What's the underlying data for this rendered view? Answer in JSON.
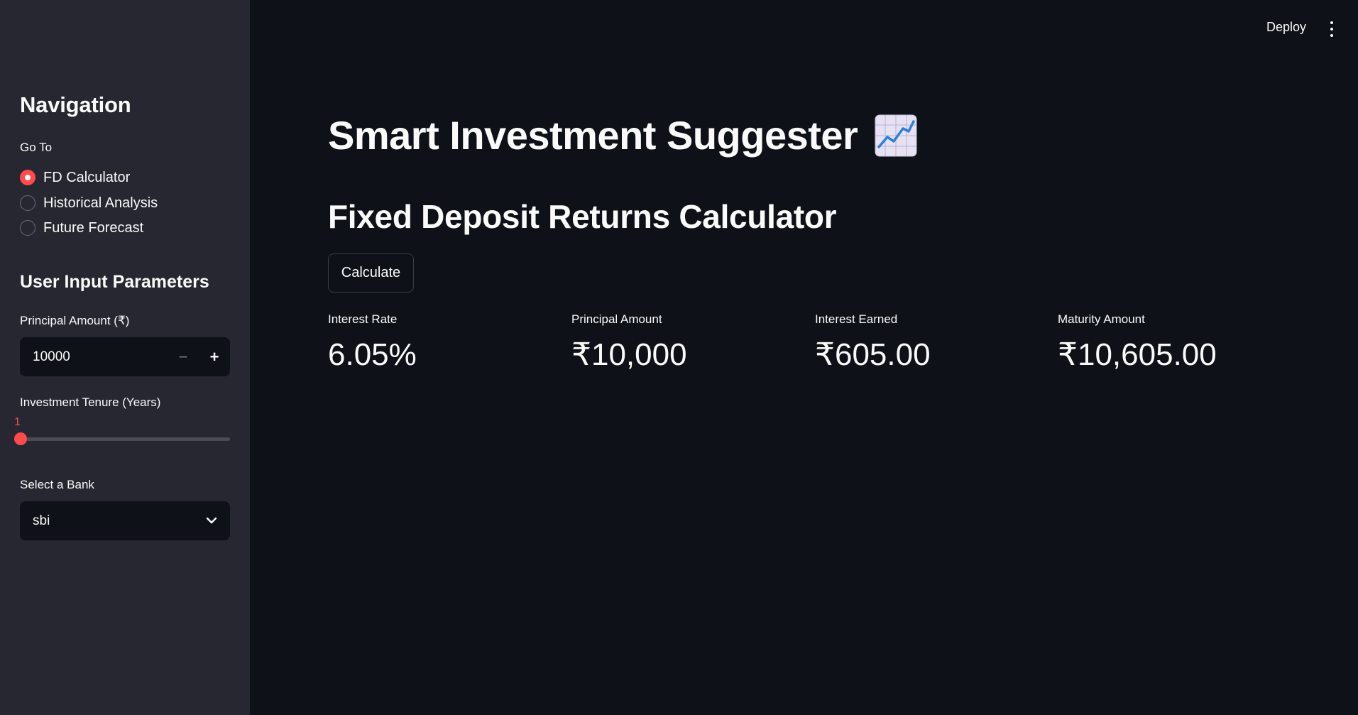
{
  "sidebar": {
    "title": "Navigation",
    "goto_label": "Go To",
    "nav_options": [
      {
        "label": "FD Calculator",
        "selected": true
      },
      {
        "label": "Historical Analysis",
        "selected": false
      },
      {
        "label": "Future Forecast",
        "selected": false
      }
    ],
    "params_title": "User Input Parameters",
    "principal": {
      "label": "Principal Amount (₹)",
      "value": "10000",
      "minus": "−",
      "plus": "+"
    },
    "tenure": {
      "label": "Investment Tenure (Years)",
      "value": "1",
      "fraction": 0
    },
    "bank": {
      "label": "Select a Bank",
      "value": "sbi"
    }
  },
  "header": {
    "deploy_label": "Deploy",
    "menu_icon": "kebab-menu-icon"
  },
  "main": {
    "title": "Smart Investment Suggester",
    "title_icon": "chart-increasing-icon",
    "section_title": "Fixed Deposit Returns Calculator",
    "calculate_label": "Calculate",
    "metrics": [
      {
        "label": "Interest Rate",
        "value": "6.05%"
      },
      {
        "label": "Principal Amount",
        "value": "₹10,000"
      },
      {
        "label": "Interest Earned",
        "value": "₹605.00"
      },
      {
        "label": "Maturity Amount",
        "value": "₹10,605.00"
      }
    ]
  },
  "colors": {
    "accent": "#ff4b4b",
    "background": "#0e1117",
    "sidebar": "#262730",
    "text": "#fafafa"
  }
}
